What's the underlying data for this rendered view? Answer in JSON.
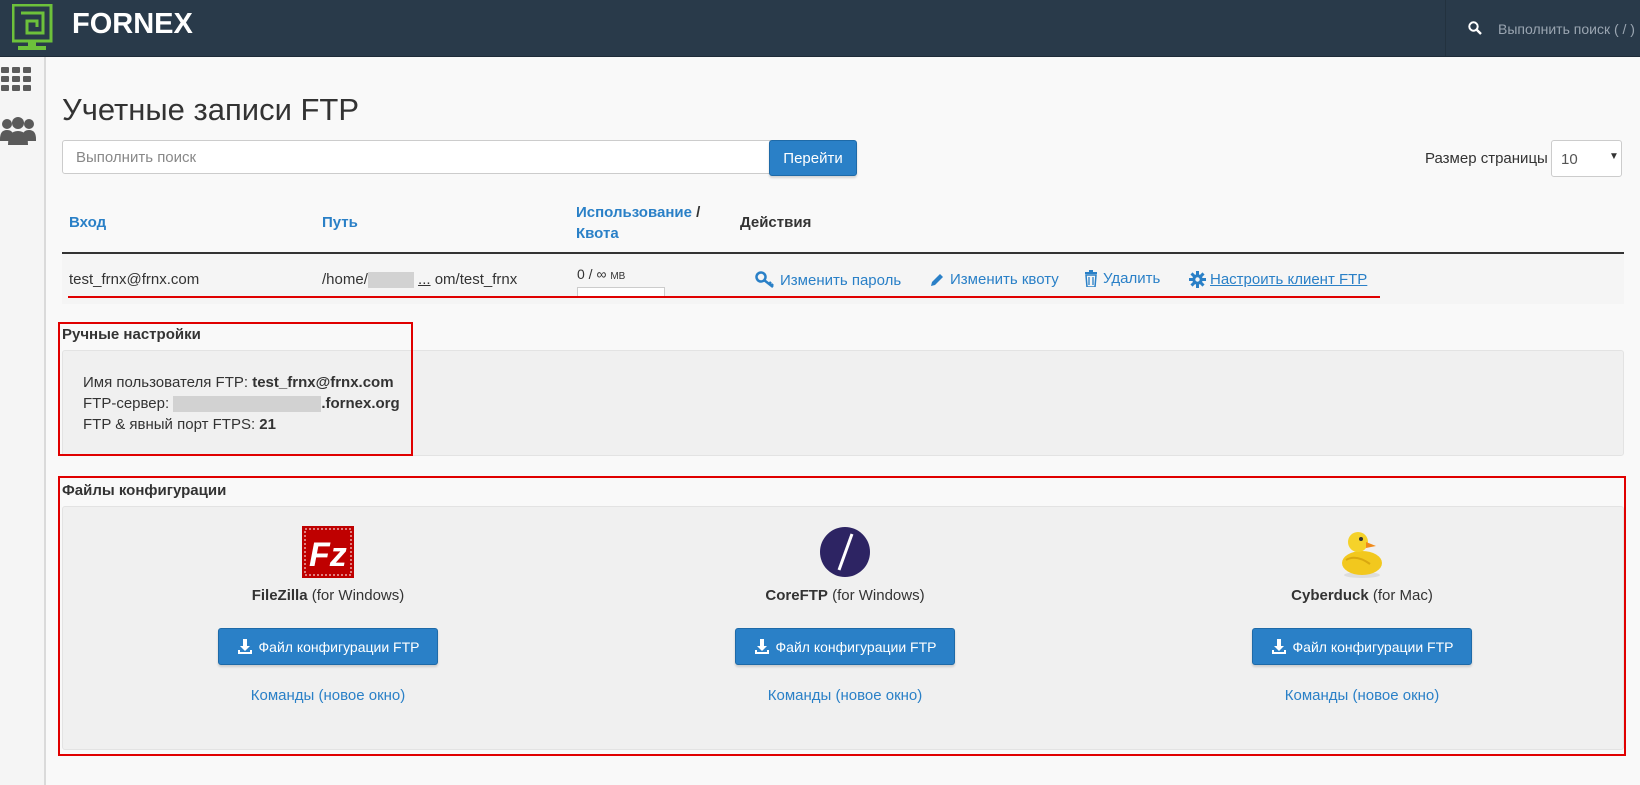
{
  "topbar": {
    "brand": "FORNEX",
    "search_placeholder": "Выполнить поиск ( / )"
  },
  "sidebar": {
    "icons": [
      "apps-grid-icon",
      "users-icon"
    ]
  },
  "page": {
    "title": "Учетные записи FTP",
    "search_placeholder": "Выполнить поиск",
    "go_button": "Перейти",
    "page_size_label": "Размер страницы",
    "page_size_value": "10"
  },
  "table": {
    "headers": {
      "login": "Вход",
      "path": "Путь",
      "usage": "Использование",
      "slash": "/",
      "quota": "Квота",
      "actions": "Действия"
    },
    "row": {
      "login": "test_frnx@frnx.com",
      "path_start": "/home/",
      "path_ellipsis": "...",
      "path_end": "om/test_frnx",
      "usage_text": "0 / ∞",
      "usage_unit": "MB",
      "usage_fraction": 0,
      "actions": {
        "change_password": "Изменить пароль",
        "change_quota": "Изменить квоту",
        "delete": "Удалить",
        "configure_client": "Настроить клиент FTP"
      }
    }
  },
  "manual": {
    "title": "Ручные настройки",
    "username_label": "Имя пользователя FTP:",
    "username_value": "test_frnx@frnx.com",
    "server_label": "FTP-сервер:",
    "server_suffix": ".fornex.org",
    "port_label": "FTP & явный порт FTPS:",
    "port_value": "21"
  },
  "config": {
    "title": "Файлы конфигурации",
    "clients": [
      {
        "name": "FileZilla",
        "platform": "(for Windows)",
        "download": "Файл конфигурации FTP",
        "commands": "Команды (новое окно)",
        "logo": "filezilla-logo"
      },
      {
        "name": "CoreFTP",
        "platform": "(for Windows)",
        "download": "Файл конфигурации FTP",
        "commands": "Команды (новое окно)",
        "logo": "coreftp-logo"
      },
      {
        "name": "Cyberduck",
        "platform": "(for Mac)",
        "download": "Файл конфигурации FTP",
        "commands": "Команды (новое окно)",
        "logo": "cyberduck-logo"
      }
    ]
  },
  "colors": {
    "topbar": "#293a4a",
    "accent": "#2a80c7",
    "logo_green": "#6dc13b",
    "highlight_red": "#e00000"
  }
}
